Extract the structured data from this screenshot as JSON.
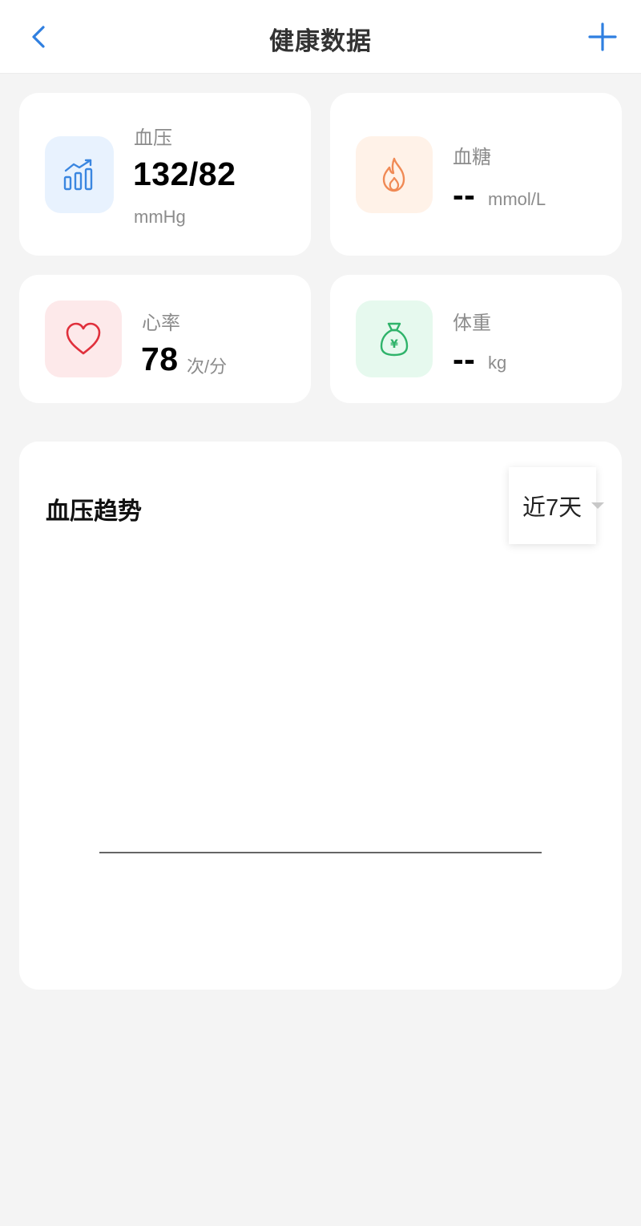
{
  "header": {
    "title": "健康数据",
    "back_icon": "chevron-left-icon",
    "add_icon": "plus-icon",
    "accent": "#2f7fe0"
  },
  "metrics": [
    {
      "label": "血压",
      "value": "132/82",
      "unit": "mmHg",
      "icon": "bar-chart-trend-icon",
      "icon_color": "#3a86e0",
      "icon_bg": "#e8f2fe"
    },
    {
      "label": "血糖",
      "value": "--",
      "unit": "mmol/L",
      "icon": "flame-icon",
      "icon_color": "#f08a55",
      "icon_bg": "#fff2e8"
    },
    {
      "label": "心率",
      "value": "78",
      "unit": "次/分",
      "icon": "heart-icon",
      "icon_color": "#e0303c",
      "icon_bg": "#fde9ea"
    },
    {
      "label": "体重",
      "value": "--",
      "unit": "kg",
      "icon": "money-bag-icon",
      "icon_color": "#2fb36a",
      "icon_bg": "#e6f9ee"
    }
  ],
  "trend": {
    "title": "血压趋势",
    "range": {
      "selected": "近7天"
    }
  },
  "money_bag_glyph": "¥"
}
